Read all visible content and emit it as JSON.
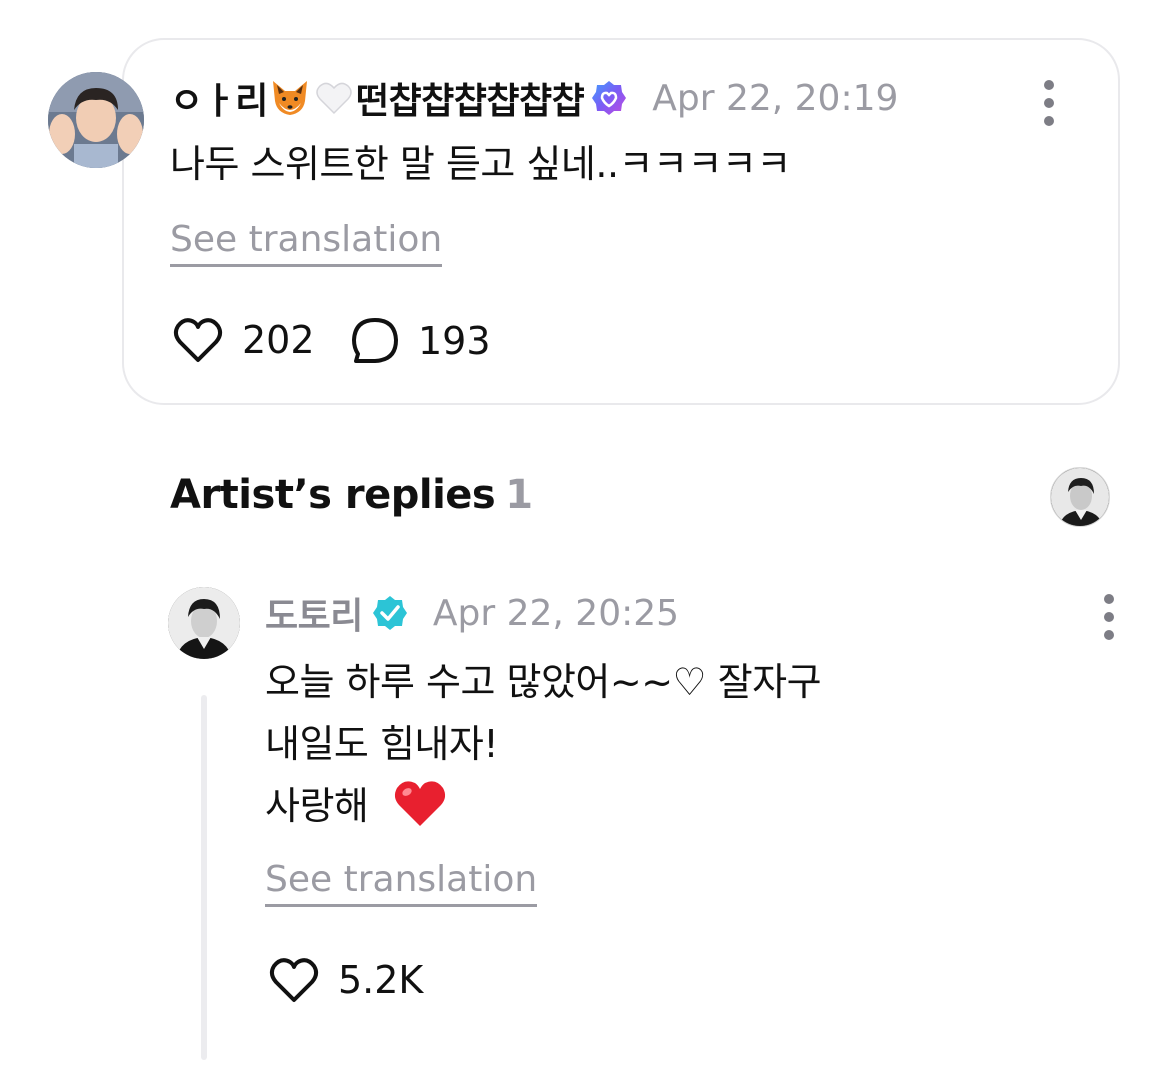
{
  "comment": {
    "username": "ㅇㅏ리",
    "username_suffix": "떤챱챱챱챱챱챱",
    "emojis": [
      "fox-emoji",
      "white-heart-emoji"
    ],
    "timestamp": "Apr 22, 20:19",
    "text": "나두 스위트한 말 듣고 싶네..ㅋㅋㅋㅋㅋ",
    "see_translation": "See translation",
    "likes": "202",
    "comments": "193"
  },
  "artist_replies": {
    "title": "Artist’s replies",
    "count": "1"
  },
  "reply": {
    "username": "도토리",
    "timestamp": "Apr 22, 20:25",
    "lines": [
      "오늘 하루 수고 많았어~~♡ 잘자구",
      "내일도 힘내자!",
      "사랑해"
    ],
    "see_translation": "See translation",
    "likes": "5.2K"
  },
  "colors": {
    "fan_verified_badge": "#7b5cf5",
    "artist_verified_badge": "#2cc4d6",
    "muted_text": "#9b9ba3",
    "card_border": "#e9e9ec"
  }
}
